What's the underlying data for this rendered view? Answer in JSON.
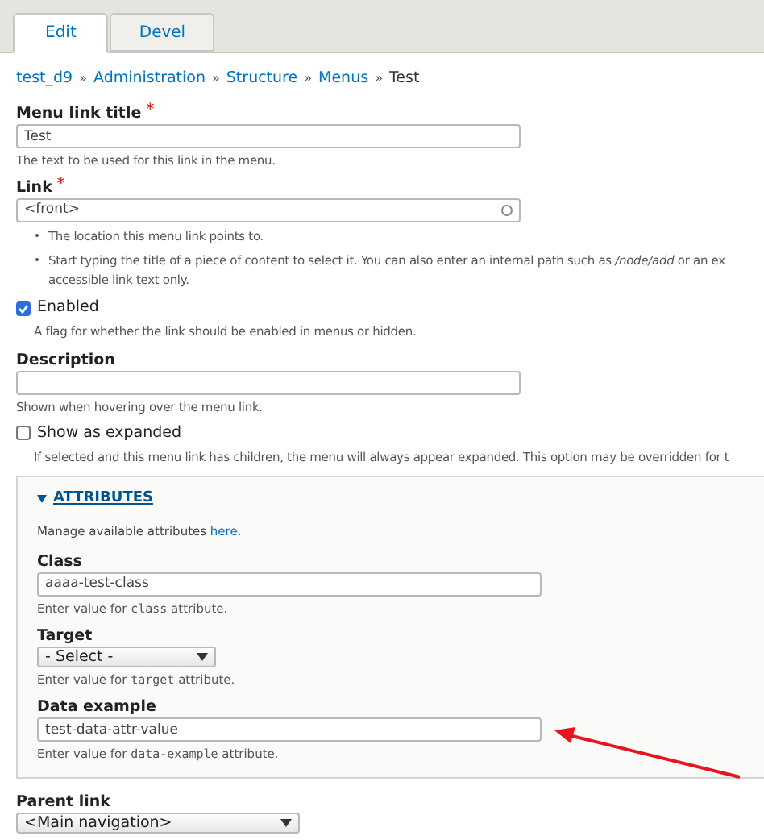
{
  "tabs": [
    {
      "label": "Edit",
      "selected": true
    },
    {
      "label": "Devel",
      "selected": false
    }
  ],
  "breadcrumb": [
    {
      "label": "test_d9",
      "kind": "link"
    },
    {
      "label": "Administration",
      "kind": "link"
    },
    {
      "label": "Structure",
      "kind": "link"
    },
    {
      "label": "Menus",
      "kind": "link"
    },
    {
      "label": "Test",
      "kind": "current"
    }
  ],
  "breadcrumb_separator": "»",
  "fields": [
    {
      "kind": "text",
      "label": "Menu link title",
      "required_mark": "*",
      "value": "Test",
      "help": [
        "The text to be used for this link in the menu."
      ]
    },
    {
      "kind": "autocomplete",
      "label": "Link",
      "required_mark": "*",
      "value": "<front>",
      "bullets": [
        [
          "The location this menu link points to."
        ],
        [
          "Start typing the title of a piece of content to select it. You can also enter an internal path such as */node/add* or an ex",
          "accessible link text only."
        ]
      ]
    },
    {
      "kind": "checkbox",
      "label": "Enabled",
      "checked": true,
      "help": [
        "A flag for whether the link should be enabled in menus or hidden."
      ]
    },
    {
      "kind": "text",
      "label": "Description",
      "help": [
        "Shown when hovering over the menu link."
      ]
    },
    {
      "kind": "checkbox",
      "label": "Show as expanded",
      "checked": false,
      "help": [
        "If selected and this menu link has children, the menu will always appear expanded. This option may be overridden for t"
      ]
    },
    {
      "kind": "fieldset",
      "title": "ATTRIBUTES",
      "expanded": true,
      "intro": "Manage available attributes",
      "intro_link": "here",
      "intro_end": ".",
      "fields": [
        {
          "kind": "text",
          "label": "Class",
          "value": "aaaa-test-class",
          "help_code": [
            "Enter value for",
            "class",
            "attribute."
          ]
        },
        {
          "kind": "select",
          "label": "Target",
          "value": "- Select -",
          "help_code": [
            "Enter value for",
            "target",
            "attribute."
          ]
        },
        {
          "kind": "text",
          "label": "Data example",
          "value": "test-data-attr-value",
          "help_code": [
            "Enter value for",
            "data-example",
            "attribute."
          ]
        }
      ]
    },
    {
      "kind": "select",
      "label": "Parent link",
      "value": "<Main navigation>"
    }
  ]
}
